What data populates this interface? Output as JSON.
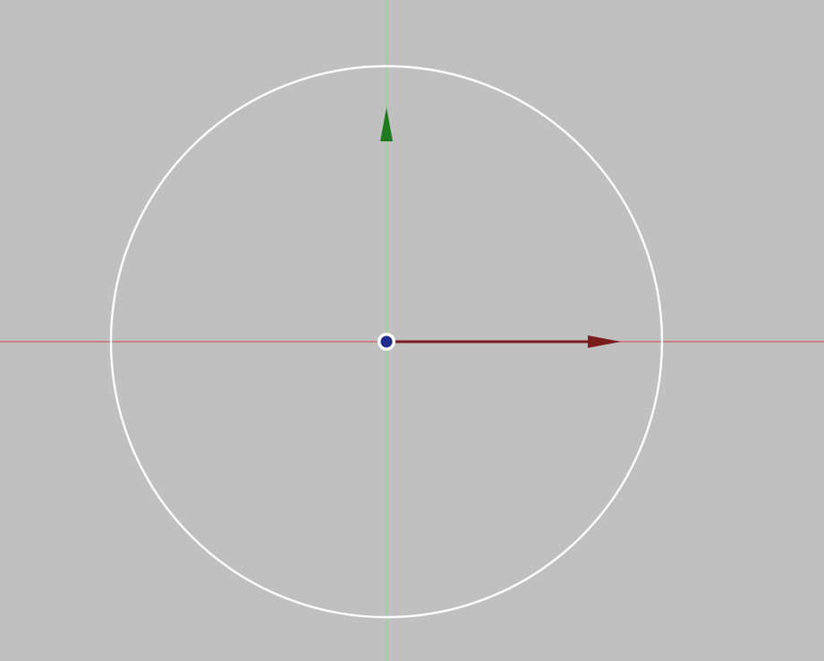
{
  "viewport": {
    "background_color": "#c0c0c0"
  },
  "colors": {
    "x_axis_line": "#d05a5a",
    "y_axis_line": "#7ee07e",
    "circle": "#ffffff",
    "x_arrow": "#7a1c1c",
    "y_arrow": "#1f7a1f",
    "origin_fill": "#1e2a8c",
    "origin_ring": "#ffffff"
  },
  "icons": {
    "x_direction": "arrow-right-icon",
    "y_direction": "arrow-up-icon",
    "origin_point": "pivot-point-icon"
  }
}
